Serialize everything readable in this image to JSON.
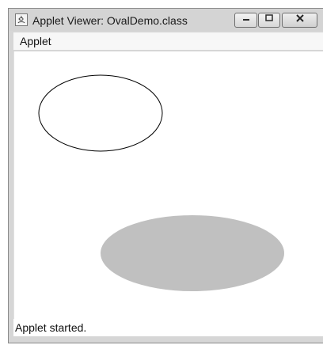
{
  "window": {
    "title": "Applet Viewer: OvalDemo.class",
    "icon": "java-applet-icon",
    "controls": [
      "minimize-icon",
      "maximize-icon",
      "close-icon"
    ]
  },
  "menu": {
    "items": [
      {
        "label": "Applet"
      }
    ]
  },
  "status": {
    "text": "Applet started."
  },
  "colors": {
    "oval_outline": "#000000",
    "filled_oval": "#c0c0c0",
    "background": "#ffffff"
  }
}
